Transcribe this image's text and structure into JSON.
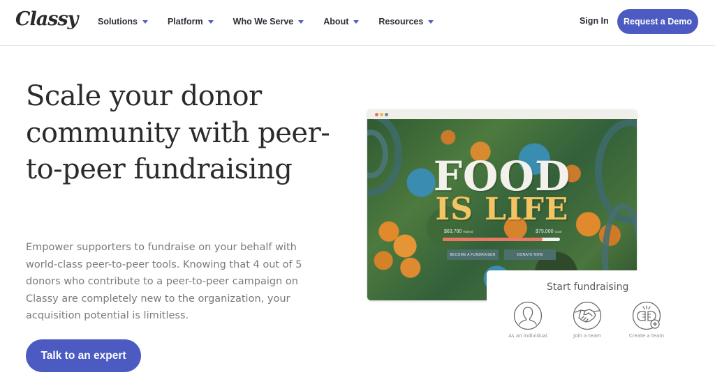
{
  "header": {
    "logo": "Classy",
    "nav": [
      {
        "label": "Solutions"
      },
      {
        "label": "Platform"
      },
      {
        "label": "Who We Serve"
      },
      {
        "label": "About"
      },
      {
        "label": "Resources"
      }
    ],
    "sign_in": "Sign In",
    "request_demo": "Request a Demo"
  },
  "hero": {
    "headline": "Scale your donor community with peer-to-peer fundraising",
    "body": "Empower supporters to fundraise on your behalf with world-class peer-to-peer tools. Knowing that 4 out of 5 donors who contribute to a peer-to-peer campaign on Classy are completely new to the organization, your acquisition potential is limitless.",
    "cta": "Talk to an expert"
  },
  "preview": {
    "title_line1": "FOOD",
    "title_line2": "IS LIFE",
    "raised_amount": "$63,700",
    "raised_label": "Raised",
    "goal_amount": "$75,000",
    "goal_label": "Goal",
    "progress_percent": 85,
    "become_fundraiser": "BECOME A FUNDRAISER",
    "donate_now": "DONATE NOW"
  },
  "start_fundraising": {
    "title": "Start fundraising",
    "options": [
      {
        "label": "As an individual",
        "icon": "person-icon"
      },
      {
        "label": "Join a team",
        "icon": "handshake-icon"
      },
      {
        "label": "Create a team",
        "icon": "fist-bump-plus-icon"
      }
    ]
  },
  "colors": {
    "brand": "#4b5bc1",
    "progress": "#e87a64",
    "food_yellow": "#f2c462",
    "button_teal": "#4d6f6c"
  }
}
